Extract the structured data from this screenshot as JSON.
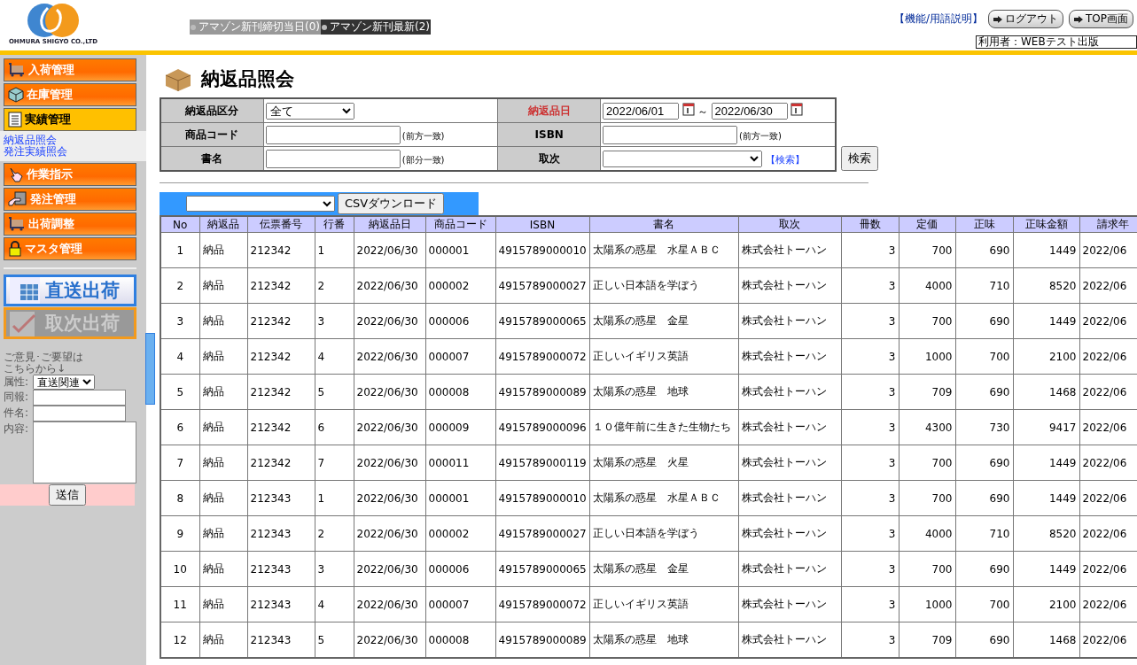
{
  "header": {
    "company": "OHMURA SHIGYO CO.,LTD",
    "notices": [
      {
        "text": "アマゾン新刊締切当日(0)",
        "kind": "plain"
      },
      {
        "text": "アマゾン新刊最新(2)",
        "kind": "dark"
      }
    ],
    "help_link": "【機能/用語説明】",
    "buttons": [
      "ログアウト",
      "TOP画面"
    ],
    "user": "利用者：WEBテスト出版"
  },
  "sidebar": {
    "menu": [
      {
        "label": "入荷管理",
        "kind": "cart",
        "selected": false
      },
      {
        "label": "在庫管理",
        "kind": "cube",
        "selected": false
      },
      {
        "label": "実績管理",
        "kind": "doc",
        "selected": true,
        "children": [
          {
            "label": "納返品照会"
          },
          {
            "label": "発注実績照会"
          }
        ]
      },
      {
        "label": "作業指示",
        "kind": "hand",
        "selected": false
      },
      {
        "label": "発注管理",
        "kind": "give",
        "selected": false
      },
      {
        "label": "出荷調整",
        "kind": "cart",
        "selected": false
      },
      {
        "label": "マスタ管理",
        "kind": "lock",
        "selected": false
      }
    ],
    "ship_buttons": [
      {
        "label": "直送出荷",
        "disabled": false
      },
      {
        "label": "取次出荷",
        "disabled": true
      }
    ],
    "feedback": {
      "intro": [
        "ご意見･ご要望は",
        "こちらから↓"
      ],
      "fields": [
        {
          "label": "属性:",
          "kind": "select",
          "value": "直送関連"
        },
        {
          "label": "同報:",
          "kind": "text"
        },
        {
          "label": "件名:",
          "kind": "text"
        },
        {
          "label": "内容:",
          "kind": "area"
        }
      ],
      "submit": "送信"
    }
  },
  "page": {
    "title": "納返品照会",
    "form": [
      [
        {
          "label": "納返品区分",
          "kind": "select",
          "value": "全て"
        },
        {
          "label": "納返品日",
          "required": true,
          "kind": "dates",
          "from": "2022/06/01",
          "sep": "～",
          "to": "2022/06/30"
        }
      ],
      [
        {
          "label": "商品コード",
          "kind": "text",
          "hint": "(前方一致)"
        },
        {
          "label": "ISBN",
          "kind": "text",
          "hint": "(前方一致)"
        }
      ],
      [
        {
          "label": "書名",
          "kind": "text",
          "hint": "(部分一致)"
        },
        {
          "label": "取次",
          "kind": "select",
          "link": "【検索】"
        }
      ]
    ],
    "search_button": "検索",
    "csv_button": "CSVダウンロード",
    "table": {
      "columns": [
        "No",
        "納返品",
        "伝票番号",
        "行番",
        "納返品日",
        "商品コード",
        "ISBN",
        "書名",
        "取次",
        "冊数",
        "定価",
        "正味",
        "正味金額",
        "請求年"
      ],
      "rows": [
        [
          "1",
          "納品",
          "212342",
          "1",
          "2022/06/30",
          "000001",
          "4915789000010",
          "太陽系の惑星　水星ＡＢＣ",
          "株式会社トーハン",
          "3",
          "700",
          "690",
          "1449",
          "2022/06"
        ],
        [
          "2",
          "納品",
          "212342",
          "2",
          "2022/06/30",
          "000002",
          "4915789000027",
          "正しい日本語を学ぼう",
          "株式会社トーハン",
          "3",
          "4000",
          "710",
          "8520",
          "2022/06"
        ],
        [
          "3",
          "納品",
          "212342",
          "3",
          "2022/06/30",
          "000006",
          "4915789000065",
          "太陽系の惑星　金星",
          "株式会社トーハン",
          "3",
          "700",
          "690",
          "1449",
          "2022/06"
        ],
        [
          "4",
          "納品",
          "212342",
          "4",
          "2022/06/30",
          "000007",
          "4915789000072",
          "正しいイギリス英語",
          "株式会社トーハン",
          "3",
          "1000",
          "700",
          "2100",
          "2022/06"
        ],
        [
          "5",
          "納品",
          "212342",
          "5",
          "2022/06/30",
          "000008",
          "4915789000089",
          "太陽系の惑星　地球",
          "株式会社トーハン",
          "3",
          "709",
          "690",
          "1468",
          "2022/06"
        ],
        [
          "6",
          "納品",
          "212342",
          "6",
          "2022/06/30",
          "000009",
          "4915789000096",
          "１０億年前に生きた生物たち",
          "株式会社トーハン",
          "3",
          "4300",
          "730",
          "9417",
          "2022/06"
        ],
        [
          "7",
          "納品",
          "212342",
          "7",
          "2022/06/30",
          "000011",
          "4915789000119",
          "太陽系の惑星　火星",
          "株式会社トーハン",
          "3",
          "700",
          "690",
          "1449",
          "2022/06"
        ],
        [
          "8",
          "納品",
          "212343",
          "1",
          "2022/06/30",
          "000001",
          "4915789000010",
          "太陽系の惑星　水星ＡＢＣ",
          "株式会社トーハン",
          "3",
          "700",
          "690",
          "1449",
          "2022/06"
        ],
        [
          "9",
          "納品",
          "212343",
          "2",
          "2022/06/30",
          "000002",
          "4915789000027",
          "正しい日本語を学ぼう",
          "株式会社トーハン",
          "3",
          "4000",
          "710",
          "8520",
          "2022/06"
        ],
        [
          "10",
          "納品",
          "212343",
          "3",
          "2022/06/30",
          "000006",
          "4915789000065",
          "太陽系の惑星　金星",
          "株式会社トーハン",
          "3",
          "700",
          "690",
          "1449",
          "2022/06"
        ],
        [
          "11",
          "納品",
          "212343",
          "4",
          "2022/06/30",
          "000007",
          "4915789000072",
          "正しいイギリス英語",
          "株式会社トーハン",
          "3",
          "1000",
          "700",
          "2100",
          "2022/06"
        ],
        [
          "12",
          "納品",
          "212343",
          "5",
          "2022/06/30",
          "000008",
          "4915789000089",
          "太陽系の惑星　地球",
          "株式会社トーハン",
          "3",
          "709",
          "690",
          "1468",
          "2022/06"
        ]
      ]
    }
  }
}
